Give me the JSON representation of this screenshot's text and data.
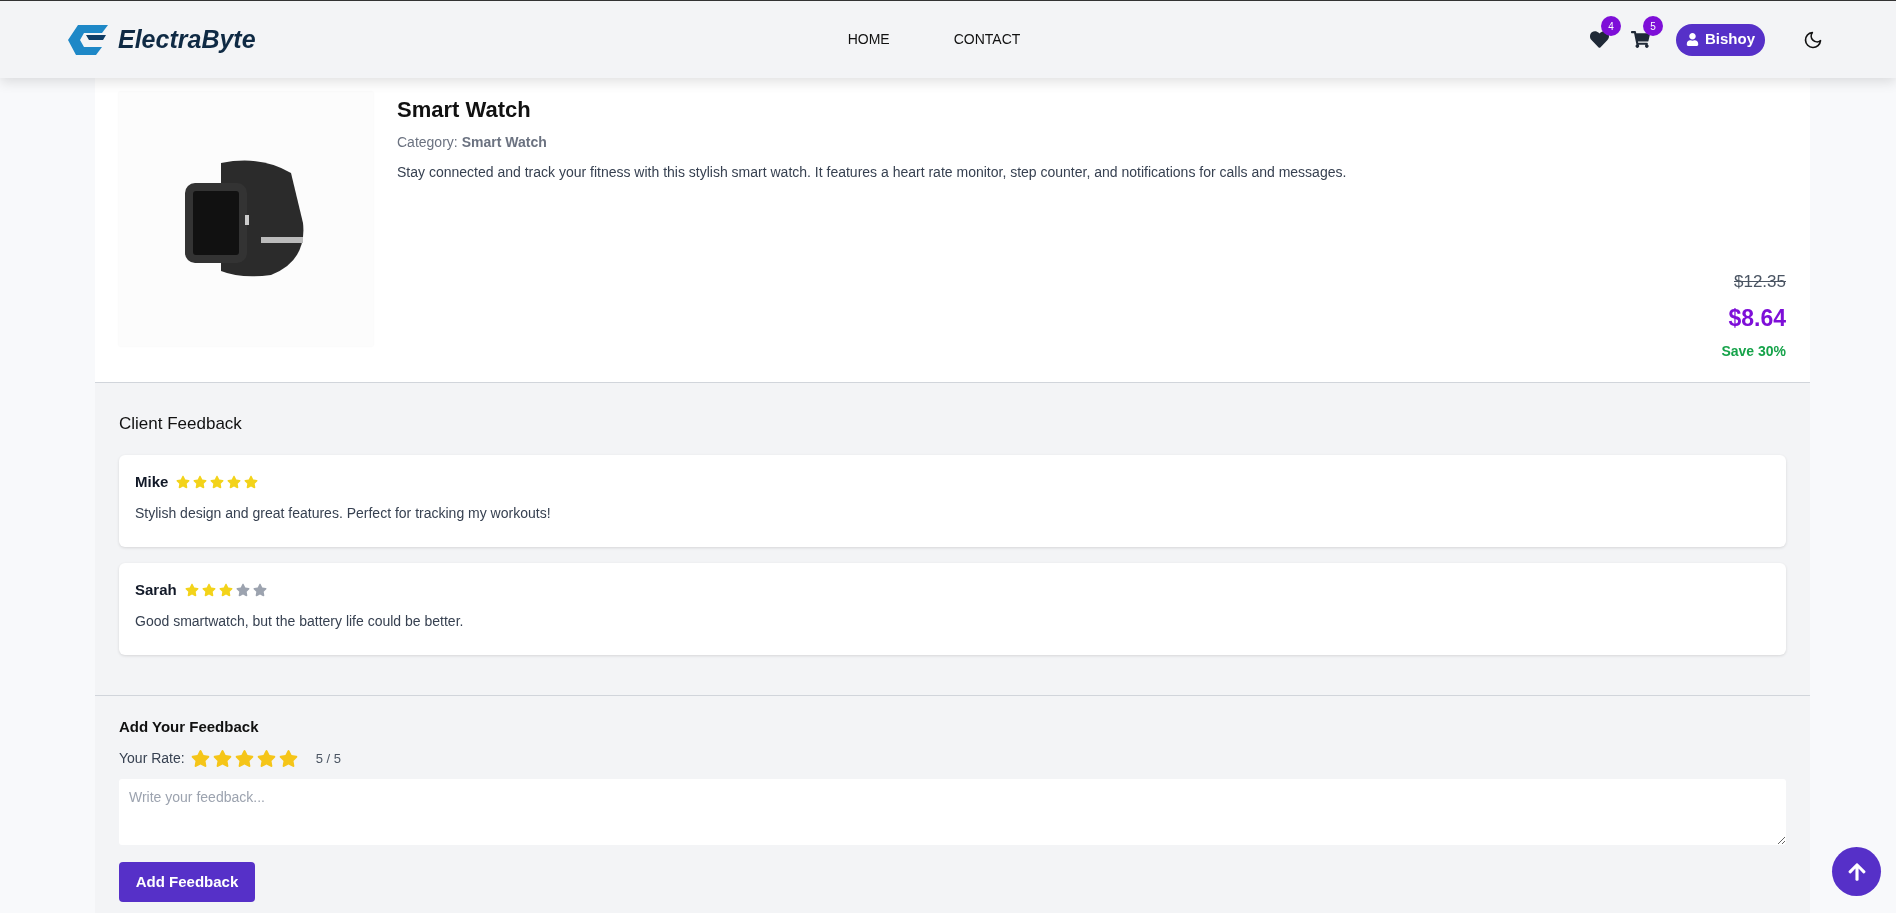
{
  "header": {
    "brand": "ElectraByte",
    "nav": [
      {
        "label": "HOME"
      },
      {
        "label": "CONTACT"
      }
    ],
    "wishlist_count": "4",
    "cart_count": "5",
    "user": "Bishoy"
  },
  "product": {
    "title": "Smart Watch",
    "category_label": "Category:",
    "category": "Smart Watch",
    "description": "Stay connected and track your fitness with this stylish smart watch. It features a heart rate monitor, step counter, and notifications for calls and messages.",
    "old_price": "$12.35",
    "price": "$8.64",
    "saving": "Save 30%"
  },
  "feedback": {
    "title": "Client Feedback",
    "reviews": [
      {
        "name": "Mike",
        "stars": 5,
        "text": "Stylish design and great features. Perfect for tracking my workouts!"
      },
      {
        "name": "Sarah",
        "stars": 3,
        "text": "Good smartwatch, but the battery life could be better."
      }
    ]
  },
  "add_feedback": {
    "title": "Add Your Feedback",
    "rate_label": "Your Rate:",
    "stars": 5,
    "rate_text": "5 / 5",
    "placeholder": "Write your feedback...",
    "button": "Add Feedback"
  }
}
